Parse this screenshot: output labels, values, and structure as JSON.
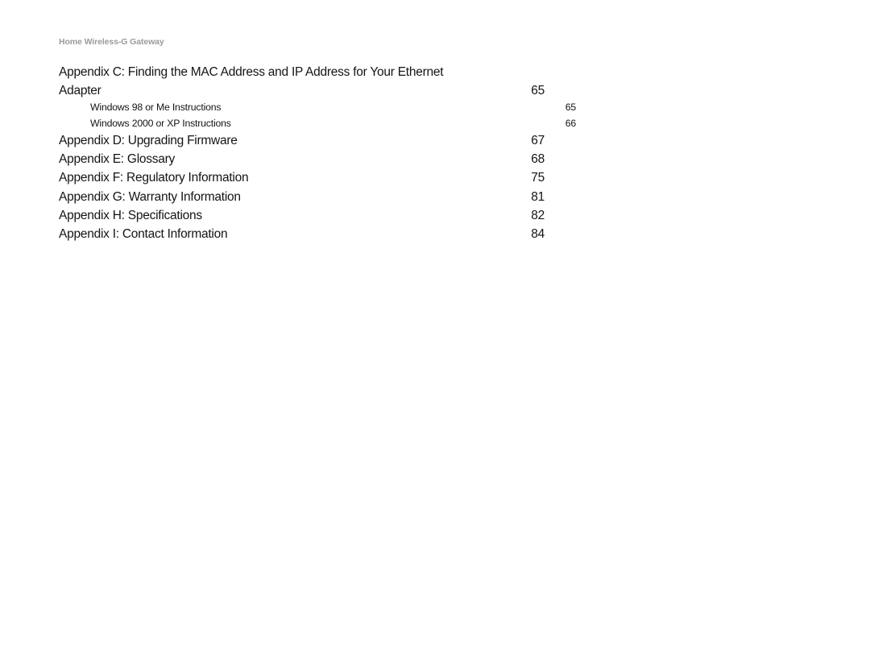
{
  "document": {
    "running_header": "Home Wireless-G Gateway",
    "background_color": "#ffffff",
    "header_color": "#9a9a9a",
    "text_color": "#141414"
  },
  "toc": {
    "entries": [
      {
        "title": "Appendix C: Finding the MAC Address and IP Address for Your Ethernet Adapter",
        "page": "65",
        "level": 1
      },
      {
        "title": "Windows 98 or Me Instructions",
        "page": "65",
        "level": 2
      },
      {
        "title": "Windows 2000 or XP Instructions",
        "page": "66",
        "level": 2
      },
      {
        "title": "Appendix D: Upgrading Firmware",
        "page": "67",
        "level": 1
      },
      {
        "title": "Appendix E: Glossary",
        "page": "68",
        "level": 1
      },
      {
        "title": "Appendix F: Regulatory Information",
        "page": "75",
        "level": 1
      },
      {
        "title": "Appendix G: Warranty Information",
        "page": "81",
        "level": 1
      },
      {
        "title": "Appendix H: Specifications",
        "page": "82",
        "level": 1
      },
      {
        "title": "Appendix I: Contact Information",
        "page": "84",
        "level": 1
      }
    ]
  }
}
